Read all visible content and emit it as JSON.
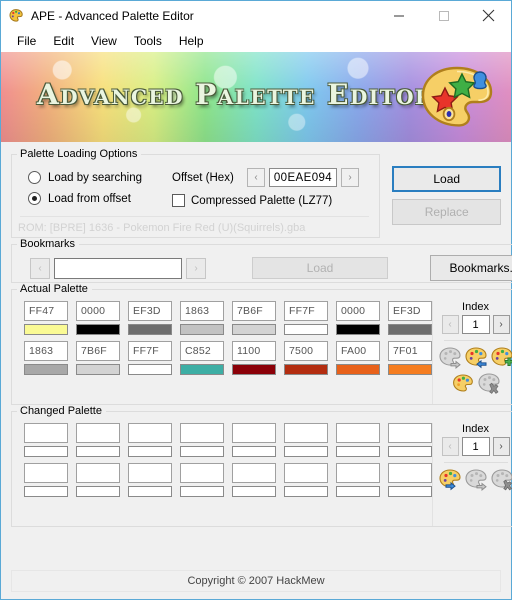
{
  "window": {
    "title": "APE - Advanced Palette Editor",
    "icon": "palette-icon",
    "minimize": "minimize-icon",
    "maximize": "maximize-icon",
    "close": "close-icon"
  },
  "menu": {
    "items": [
      {
        "label": "File"
      },
      {
        "label": "Edit"
      },
      {
        "label": "View"
      },
      {
        "label": "Tools"
      },
      {
        "label": "Help"
      }
    ]
  },
  "banner": {
    "title": "Advanced Palette Editor",
    "artwork": "palette-artwork-icon"
  },
  "loading": {
    "legend": "Palette Loading Options",
    "radio_search_label": "Load by searching",
    "radio_search_checked": false,
    "radio_offset_label": "Load from offset",
    "radio_offset_checked": true,
    "offset_label": "Offset (Hex)",
    "offset_value": "00EAE094",
    "offset_prev": "‹",
    "offset_next": "›",
    "compressed_label": "Compressed Palette (LZ77)",
    "compressed_checked": false,
    "rom_text": "ROM: [BPRE] 1636 - Pokemon Fire Red (U)(Squirrels).gba"
  },
  "actions": {
    "load_label": "Load",
    "load_enabled": true,
    "replace_label": "Replace",
    "replace_enabled": false
  },
  "bookmarks": {
    "legend": "Bookmarks",
    "prev": "‹",
    "next": "›",
    "field_value": "",
    "load_label": "Load",
    "load_enabled": false,
    "open_label": "Bookmarks..."
  },
  "actual_palette": {
    "legend": "Actual Palette",
    "index_label": "Index",
    "index_value": "1",
    "prev": "‹",
    "next": "›",
    "rows": [
      [
        {
          "hex": "FF47",
          "color": "#fafa94"
        },
        {
          "hex": "0000",
          "color": "#000000"
        },
        {
          "hex": "EF3D",
          "color": "#6e6e6e"
        },
        {
          "hex": "1863",
          "color": "#c2c2c2"
        },
        {
          "hex": "7B6F",
          "color": "#d3d3d3"
        },
        {
          "hex": "FF7F",
          "color": "#ffffff"
        },
        {
          "hex": "0000",
          "color": "#000000"
        },
        {
          "hex": "EF3D",
          "color": "#6e6e6e"
        }
      ],
      [
        {
          "hex": "1863",
          "color": "#a8a8a8"
        },
        {
          "hex": "7B6F",
          "color": "#d3d3d3"
        },
        {
          "hex": "FF7F",
          "color": "#ffffff"
        },
        {
          "hex": "C852",
          "color": "#3daea4"
        },
        {
          "hex": "1100",
          "color": "#8b0008"
        },
        {
          "hex": "7500",
          "color": "#b32d10"
        },
        {
          "hex": "FA00",
          "color": "#e8611a"
        },
        {
          "hex": "7F01",
          "color": "#f57d20"
        }
      ]
    ],
    "icons": [
      {
        "name": "palette-load-from-rom-icon",
        "enabled": false
      },
      {
        "name": "palette-import-icon",
        "enabled": true
      },
      {
        "name": "palette-add-icon",
        "enabled": true
      },
      {
        "name": "palette-edit-icon",
        "enabled": true
      },
      {
        "name": "palette-delete-icon",
        "enabled": false
      }
    ]
  },
  "changed_palette": {
    "legend": "Changed Palette",
    "index_label": "Index",
    "index_value": "1",
    "prev": "‹",
    "next": "›",
    "rows": [
      [
        {
          "hex": "",
          "color": "#ffffff"
        },
        {
          "hex": "",
          "color": "#ffffff"
        },
        {
          "hex": "",
          "color": "#ffffff"
        },
        {
          "hex": "",
          "color": "#ffffff"
        },
        {
          "hex": "",
          "color": "#ffffff"
        },
        {
          "hex": "",
          "color": "#ffffff"
        },
        {
          "hex": "",
          "color": "#ffffff"
        },
        {
          "hex": "",
          "color": "#ffffff"
        }
      ],
      [
        {
          "hex": "",
          "color": "#ffffff"
        },
        {
          "hex": "",
          "color": "#ffffff"
        },
        {
          "hex": "",
          "color": "#ffffff"
        },
        {
          "hex": "",
          "color": "#ffffff"
        },
        {
          "hex": "",
          "color": "#ffffff"
        },
        {
          "hex": "",
          "color": "#ffffff"
        },
        {
          "hex": "",
          "color": "#ffffff"
        },
        {
          "hex": "",
          "color": "#ffffff"
        }
      ]
    ],
    "icons": [
      {
        "name": "palette-apply-icon",
        "enabled": true
      },
      {
        "name": "palette-export-icon",
        "enabled": false
      },
      {
        "name": "palette-clear-icon",
        "enabled": false
      }
    ]
  },
  "statusbar": {
    "text": "Copyright © 2007 HackMew"
  },
  "colors": {
    "accent": "#2a7ec0",
    "window_border": "#5aa9d6",
    "face": "#f0f0f0"
  }
}
